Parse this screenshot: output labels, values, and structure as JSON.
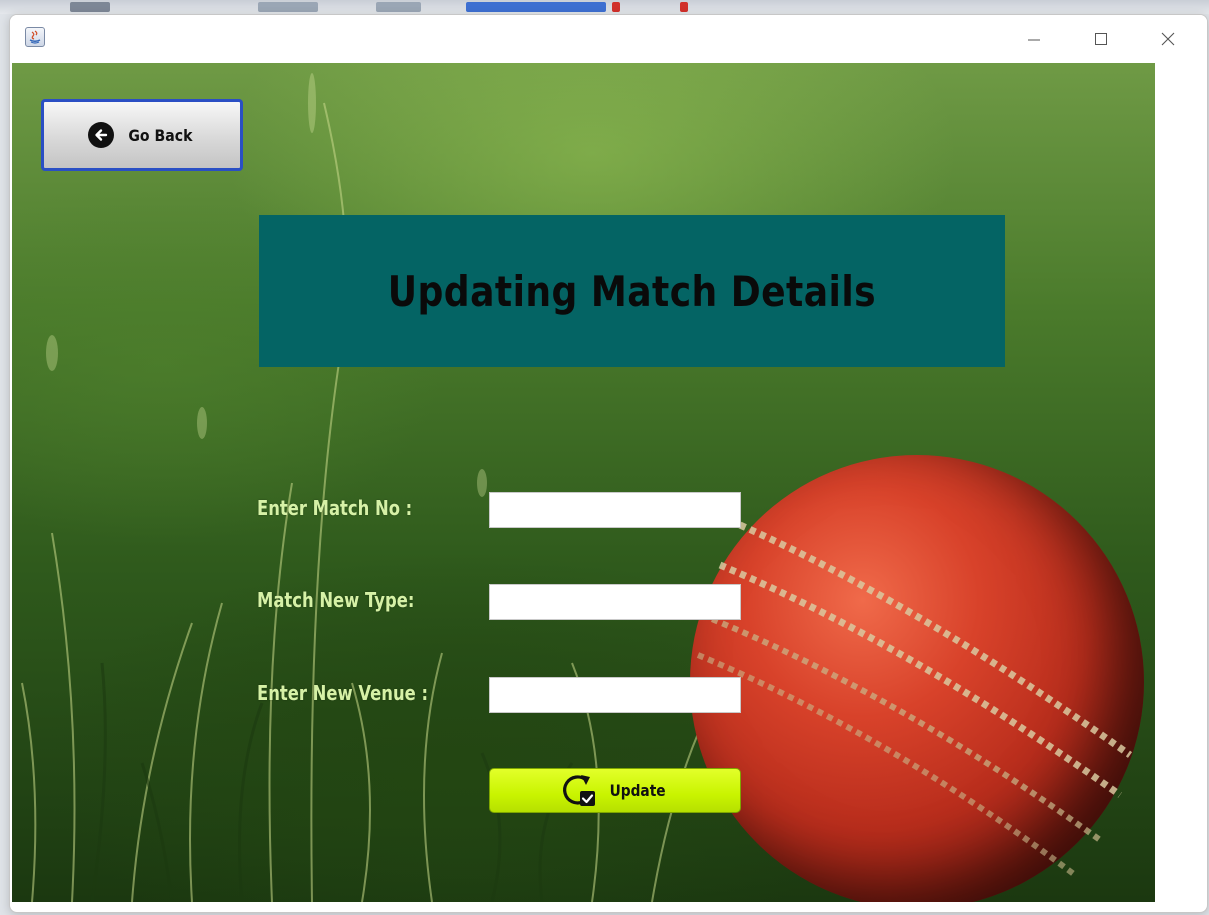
{
  "window": {
    "minimize_icon": "minimize-icon",
    "maximize_icon": "maximize-icon",
    "close_icon": "close-icon",
    "app_icon": "java-app-icon"
  },
  "back_button": {
    "label": "Go Back",
    "icon": "arrow-left-circle-icon"
  },
  "header": {
    "title": "Updating Match Details"
  },
  "form": {
    "fields": [
      {
        "label": "Enter Match No :",
        "value": ""
      },
      {
        "label": "Match New Type:",
        "value": ""
      },
      {
        "label": "Enter New Venue :",
        "value": ""
      }
    ],
    "submit": {
      "label": "Update",
      "icon": "refresh-check-icon"
    }
  },
  "colors": {
    "title_banner": "#046464",
    "label_text": "#d6f1a6",
    "update_button": "#c9f400",
    "back_button_border": "#2a4fc4"
  }
}
